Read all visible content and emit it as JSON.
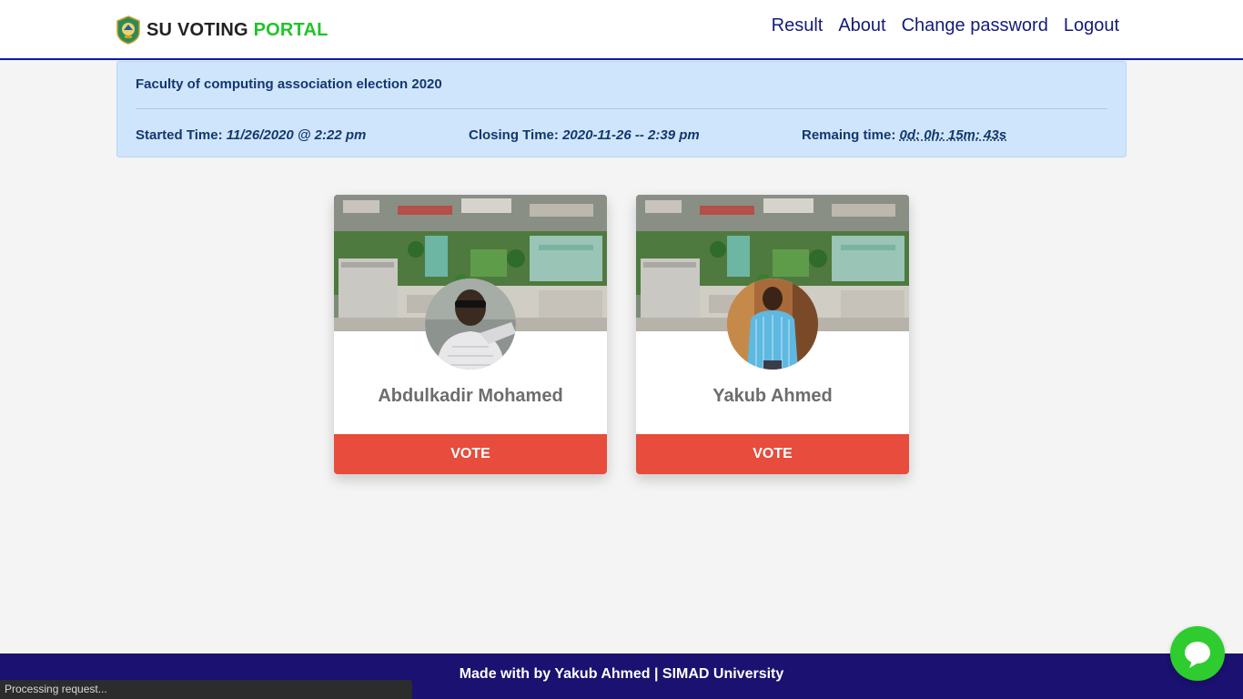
{
  "brand": {
    "name": "SU VOTING ",
    "accent": "PORTAL",
    "accent_color": "#22c32a",
    "logo_icon": "university-crest-icon"
  },
  "nav": {
    "items": [
      "Result",
      "About",
      "Change password",
      "Logout"
    ]
  },
  "election": {
    "title": "Faculty of computing association election 2020",
    "started_label": "Started Time:",
    "started_value": "11/26/2020 @ 2:22 pm",
    "closing_label": "Closing Time:",
    "closing_value": "2020-11-26 -- 2:39 pm",
    "remaining_label": "Remaing time:",
    "remaining_value": "0d: 0h: 15m: 43s"
  },
  "candidates": [
    {
      "name": "Abdulkadir Mohamed",
      "vote_label": "VOTE"
    },
    {
      "name": "Yakub Ahmed",
      "vote_label": "VOTE"
    }
  ],
  "footer": {
    "prefix": "Made with",
    "heart_glyph": "",
    "suffix": "by Yakub Ahmed | SIMAD University"
  },
  "status_bar": {
    "text": "Processing request..."
  },
  "chat": {
    "icon": "chat-bubble-icon"
  },
  "colors": {
    "nav_text": "#141b7a",
    "vote_button": "#e74c3c",
    "footer_bg": "#1a1170",
    "info_bg": "#cfe5fb",
    "chat_bg": "#2ecc2e"
  }
}
